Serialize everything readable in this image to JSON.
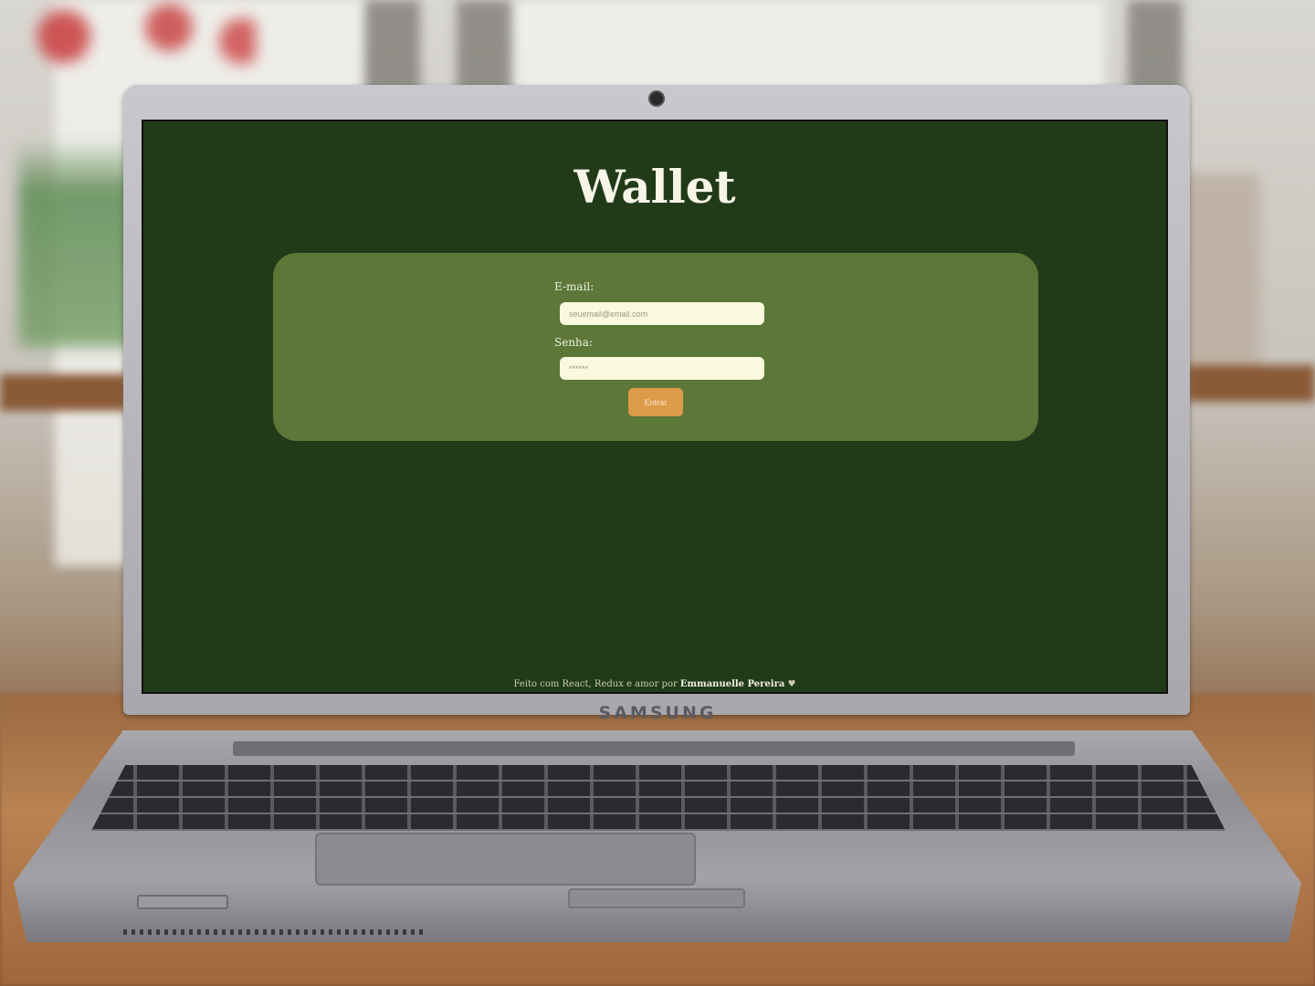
{
  "device": {
    "brand": "SAMSUNG"
  },
  "app": {
    "title": "Wallet",
    "form": {
      "email_label": "E-mail:",
      "email_placeholder": "seuemail@email.com",
      "password_label": "Senha:",
      "password_placeholder": "******",
      "submit_label": "Entrar"
    },
    "footer": {
      "text": "Feito com React, Redux e amor por ",
      "author": "Emmanuelle Pereira",
      "heart": "♥"
    }
  },
  "colors": {
    "page_bg": "#213b18",
    "card_bg": "#5c7738",
    "input_bg": "#f9f9de",
    "button_bg": "#dd9a47"
  }
}
